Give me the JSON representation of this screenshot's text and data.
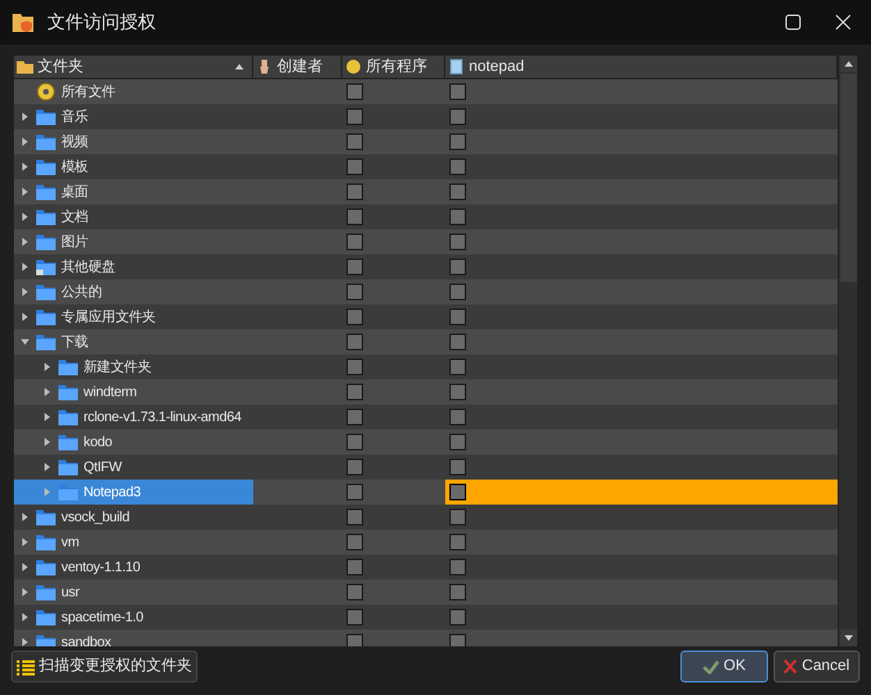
{
  "window": {
    "title": "文件访问授权"
  },
  "table": {
    "columns": [
      {
        "label": "文件夹",
        "sorted": true
      },
      {
        "label": "创建者",
        "sorted": false
      },
      {
        "label": "所有程序",
        "sorted": false
      },
      {
        "label": "notepad",
        "sorted": false
      }
    ],
    "rows": [
      {
        "name": "所有文件",
        "kind": "all",
        "selected": false,
        "all_programs": false,
        "notepad": false
      },
      {
        "name": "音乐",
        "kind": "folder",
        "expanded": false,
        "selected": false,
        "all_programs": false,
        "notepad": false
      },
      {
        "name": "视频",
        "kind": "folder",
        "expanded": false,
        "selected": false,
        "all_programs": false,
        "notepad": false
      },
      {
        "name": "模板",
        "kind": "folder",
        "expanded": false,
        "selected": false,
        "all_programs": false,
        "notepad": false
      },
      {
        "name": "桌面",
        "kind": "folder",
        "expanded": false,
        "selected": false,
        "all_programs": false,
        "notepad": false
      },
      {
        "name": "文档",
        "kind": "folder",
        "expanded": false,
        "selected": false,
        "all_programs": false,
        "notepad": false
      },
      {
        "name": "图片",
        "kind": "folder",
        "expanded": false,
        "selected": false,
        "all_programs": false,
        "notepad": false
      },
      {
        "name": "其他硬盘",
        "kind": "drive",
        "expanded": false,
        "selected": false,
        "all_programs": false,
        "notepad": false
      },
      {
        "name": "公共的",
        "kind": "folder",
        "expanded": false,
        "selected": false,
        "all_programs": false,
        "notepad": false
      },
      {
        "name": "专属应用文件夹",
        "kind": "folder",
        "expanded": false,
        "selected": false,
        "all_programs": false,
        "notepad": false
      },
      {
        "name": "下载",
        "kind": "folder",
        "expanded": true,
        "selected": false,
        "all_programs": false,
        "notepad": false,
        "children": [
          {
            "name": "新建文件夹",
            "kind": "folder",
            "expanded": false,
            "selected": false,
            "all_programs": false,
            "notepad": false
          },
          {
            "name": "windterm",
            "kind": "folder",
            "expanded": false,
            "selected": false,
            "all_programs": false,
            "notepad": false
          },
          {
            "name": "rclone-v1.73.1-linux-amd64",
            "kind": "folder",
            "expanded": false,
            "selected": false,
            "all_programs": false,
            "notepad": false
          },
          {
            "name": "kodo",
            "kind": "folder",
            "expanded": false,
            "selected": false,
            "all_programs": false,
            "notepad": false
          },
          {
            "name": "QtIFW",
            "kind": "folder",
            "expanded": false,
            "selected": false,
            "all_programs": false,
            "notepad": false
          },
          {
            "name": "Notepad3",
            "kind": "folder",
            "expanded": false,
            "selected": true,
            "all_programs": false,
            "notepad": false
          }
        ]
      },
      {
        "name": "vsock_build",
        "kind": "folder",
        "expanded": false,
        "selected": false,
        "all_programs": false,
        "notepad": false
      },
      {
        "name": "vm",
        "kind": "folder",
        "expanded": false,
        "selected": false,
        "all_programs": false,
        "notepad": false
      },
      {
        "name": "ventoy-1.1.10",
        "kind": "folder",
        "expanded": false,
        "selected": false,
        "all_programs": false,
        "notepad": false
      },
      {
        "name": "usr",
        "kind": "folder",
        "expanded": false,
        "selected": false,
        "all_programs": false,
        "notepad": false
      },
      {
        "name": "spacetime-1.0",
        "kind": "folder",
        "expanded": false,
        "selected": false,
        "all_programs": false,
        "notepad": false
      },
      {
        "name": "sandbox",
        "kind": "folder",
        "expanded": false,
        "selected": false,
        "all_programs": false,
        "notepad": false
      }
    ]
  },
  "buttons": {
    "scan": "扫描变更授权的文件夹",
    "ok": "OK",
    "cancel": "Cancel"
  }
}
